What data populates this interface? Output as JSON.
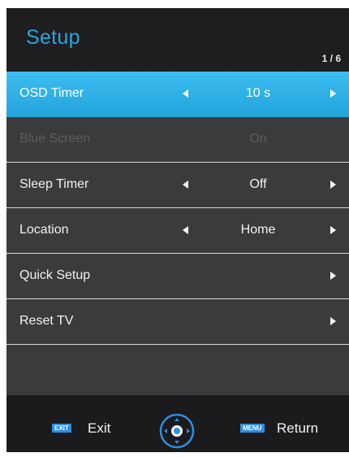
{
  "header": {
    "title": "Setup",
    "page_indicator": "1 / 6"
  },
  "menu": [
    {
      "label": "OSD Timer",
      "value": "10 s",
      "state": "selected",
      "has_left_arrow": true,
      "has_right_arrow": true
    },
    {
      "label": "Blue Screen",
      "value": "On",
      "state": "disabled",
      "has_left_arrow": false,
      "has_right_arrow": false
    },
    {
      "label": "Sleep Timer",
      "value": "Off",
      "state": "normal",
      "has_left_arrow": true,
      "has_right_arrow": true
    },
    {
      "label": "Location",
      "value": "Home",
      "state": "normal",
      "has_left_arrow": true,
      "has_right_arrow": true
    },
    {
      "label": "Quick Setup",
      "value": "",
      "state": "normal",
      "has_left_arrow": false,
      "has_right_arrow": true
    },
    {
      "label": "Reset TV",
      "value": "",
      "state": "normal",
      "has_left_arrow": false,
      "has_right_arrow": true
    }
  ],
  "footer": {
    "exit_key": "EXIT",
    "exit_label": "Exit",
    "return_key": "MENU",
    "return_label": "Return",
    "navigation_icon": "dpad-navigation-icon"
  },
  "colors": {
    "accent": "#2aa6df",
    "selected_row": "#22a4dc",
    "background": "#3b3b3d",
    "header": "#1e1e20",
    "key_badge": "#2f8fe0"
  }
}
